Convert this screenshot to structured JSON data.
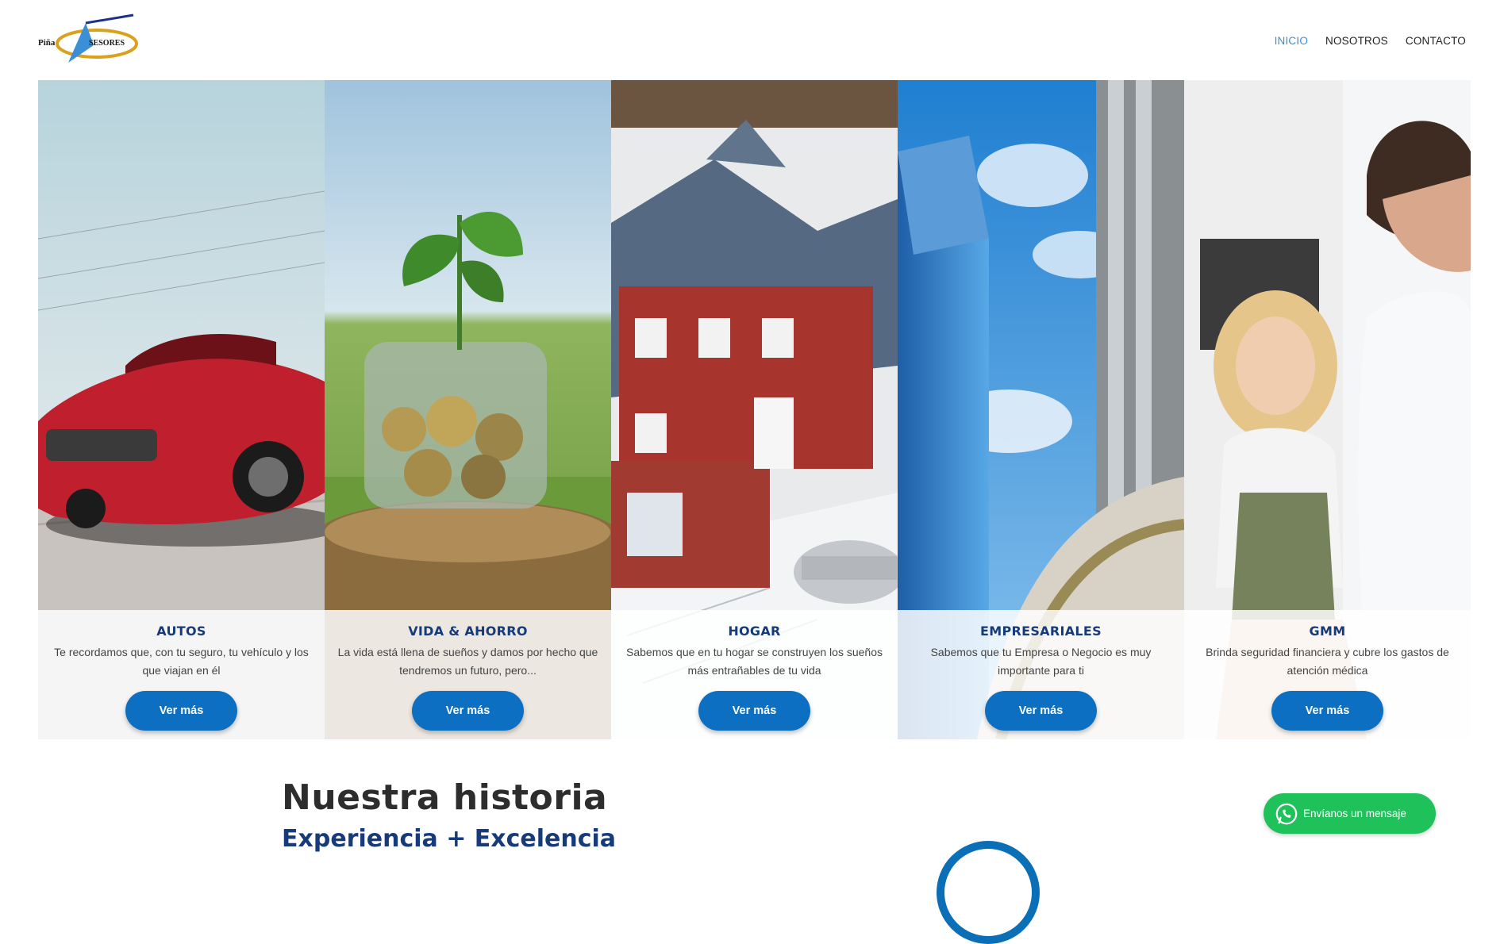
{
  "logo": {
    "text_left": "Piña",
    "text_right": "SESORES",
    "letter": "A"
  },
  "nav": {
    "items": [
      {
        "label": "INICIO",
        "active": true
      },
      {
        "label": "NOSOTROS",
        "active": false
      },
      {
        "label": "CONTACTO",
        "active": false
      }
    ]
  },
  "panels": [
    {
      "title": "AUTOS",
      "text": "Te recordamos que, con tu seguro, tu vehículo y los que viajan en él",
      "button": "Ver más",
      "image": "red-convertible-car"
    },
    {
      "title": "VIDA & AHORRO",
      "text": "La vida está llena de sueños y damos por hecho que tendremos un futuro, pero...",
      "button": "Ver más",
      "image": "plant-growing-from-coin-jar"
    },
    {
      "title": "HOGAR",
      "text": "Sabemos que en tu hogar se construyen los sueños más entrañables de tu vida",
      "button": "Ver más",
      "image": "house-model-with-keys"
    },
    {
      "title": "EMPRESARIALES",
      "text": "Sabemos que tu Empresa o Negocio es muy importante para ti",
      "button": "Ver más",
      "image": "glass-office-building"
    },
    {
      "title": "GMM",
      "text": "Brinda seguridad financiera y cubre los gastos de atención médica",
      "button": "Ver más",
      "image": "doctor-with-child"
    }
  ],
  "history": {
    "title": "Nuestra historia",
    "subtitle": "Experiencia + Excelencia"
  },
  "whatsapp": {
    "label": "Envíanos un mensaje",
    "icon": "whatsapp-icon",
    "color": "#1fc15a"
  },
  "colors": {
    "accent": "#0d6fc1",
    "heading": "#173b7a",
    "nav_active": "#3a8fd6"
  }
}
